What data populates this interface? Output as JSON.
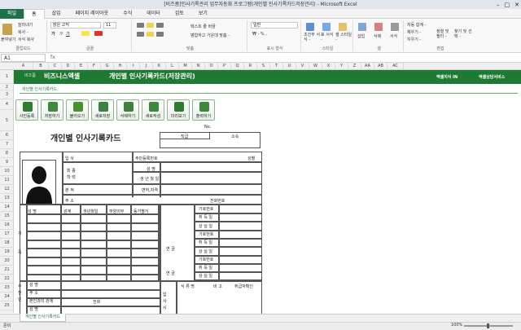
{
  "window": {
    "title": "[비즈폼]인사기록관리 업무자동화 프로그램(개인별 인사기록카드저장관리) - Microsoft Excel"
  },
  "tabs": [
    "파일",
    "홈",
    "삽입",
    "페이지 레이아웃",
    "수식",
    "데이터",
    "검토",
    "보기"
  ],
  "ribbon": {
    "clipboard": {
      "paste": "붙여넣기",
      "cut": "잘라내기",
      "copy": "복사 -",
      "format": "서식 복사",
      "label": "클립보드"
    },
    "font": {
      "name": "맑은 고딕",
      "size": "11",
      "label": "글꼴"
    },
    "align": {
      "wrap": "텍스트 줄 바꿈",
      "merge": "병합하고 가운데 맞춤 -",
      "label": "맞춤"
    },
    "number": {
      "format": "일반",
      "label": "표시 형식"
    },
    "styles": {
      "cond": "조건부 서식 -",
      "table": "표 서식 -",
      "cell": "셀 스타일 -",
      "label": "스타일"
    },
    "cells": {
      "insert": "삽입",
      "delete": "삭제",
      "format": "서식",
      "label": "셀"
    },
    "edit": {
      "autosum": "자동 합계 -",
      "fill": "채우기 -",
      "clear": "지우기 -",
      "sort": "정렬 및 필터 -",
      "find": "찾기 및 선택 -",
      "label": "편집"
    }
  },
  "formula": {
    "namebox": "A1",
    "fx": "fx"
  },
  "columns": [
    "A",
    "B",
    "C",
    "D",
    "E",
    "F",
    "G",
    "H",
    "I",
    "J",
    "K",
    "L",
    "M",
    "N",
    "O",
    "P",
    "Q",
    "R",
    "S",
    "T",
    "U",
    "V",
    "W",
    "X",
    "Y",
    "Z",
    "AA",
    "AB",
    "AC"
  ],
  "rows": [
    "1",
    "2",
    "3",
    "4",
    "5",
    "6",
    "7",
    "8",
    "9",
    "10",
    "11",
    "12",
    "13",
    "14",
    "15",
    "16",
    "17",
    "18",
    "19",
    "20",
    "21",
    "22",
    "23",
    "24",
    "25",
    "26",
    "27"
  ],
  "banner": {
    "brand_small": "비즈폼",
    "brand": "비즈니스엑셀",
    "title": "개인별 인사기록카드(저장관리)",
    "right1": "엑셀지식 IN",
    "right2": "엑셀상담서비스"
  },
  "sub": "개인별 인사기록카드",
  "buttons": [
    "사진등록",
    "저장하기",
    "불러오기",
    "새로저장",
    "삭제하기",
    "새로작성",
    "미리보기",
    "출력하기"
  ],
  "card": {
    "title": "개인별 인사기록카드",
    "no": "No.",
    "rank": "직급",
    "dept": "소속",
    "name_lbl": "성 명",
    "hanja_lbl": "한 자",
    "name": "입 사",
    "final_edu": "최 종\n학 력",
    "origin": "본 적",
    "address": "주 소",
    "resident": "주민등록번호",
    "gender": "성별",
    "name2": "성 명",
    "birth": "생 년 월 일",
    "license": "면허,자격",
    "phone": "전화번호",
    "family": "가 족",
    "fam_cols": [
      "성 명",
      "관계",
      "생년월일",
      "부양의무",
      "동거별거"
    ],
    "pension": "연 금",
    "ins_rows": [
      "기호번호",
      "취 득 일",
      "상 실 일",
      "기호번호",
      "취 득 일",
      "상 실 일",
      "기호번호",
      "취 득 일",
      "상 실 일"
    ],
    "guarantor": "추 천 인",
    "g_rows": [
      "성 명",
      "주 소",
      "본인과의 관계",
      "성 명"
    ],
    "g_phone": "전화",
    "history": "입 사 시",
    "h_cols": [
      "서 류 명",
      "비 고",
      "취급자확인"
    ]
  },
  "sheet_tab": "개인별 인사기록카드",
  "status": {
    "ready": "준비",
    "zoom": "100%"
  },
  "colors": {
    "accent": "#1e7145",
    "banner": "#1e7a32"
  }
}
